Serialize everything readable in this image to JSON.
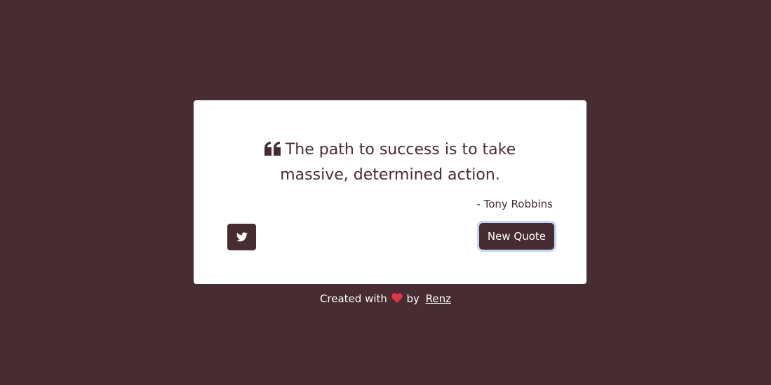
{
  "quote": {
    "text": "The path to success is to take massive, determined action.",
    "author": "- Tony Robbins",
    "icon": "quote-left-icon"
  },
  "actions": {
    "tweet_icon": "twitter-icon",
    "new_quote_label": "New Quote"
  },
  "footer": {
    "prefix": "Created with",
    "heart_icon": "heart-icon",
    "by": "by",
    "author_link": "Renz"
  },
  "colors": {
    "background": "#472c32",
    "card": "#ffffff",
    "accent": "#472c32",
    "heart": "#e03444",
    "focus_ring": "#c2d6f5"
  }
}
